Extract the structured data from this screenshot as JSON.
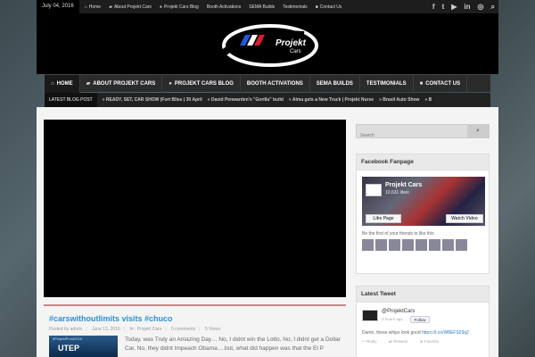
{
  "topbar": {
    "date": "July 04, 2016",
    "nav": [
      {
        "icon": "home-icon",
        "glyph": "⌂",
        "label": "Home"
      },
      {
        "icon": "car-icon",
        "glyph": "▰",
        "label": "About Projekt Cars"
      },
      {
        "icon": "chat-icon",
        "glyph": "●",
        "label": "Projekt Cars Blog"
      },
      {
        "icon": "",
        "glyph": "",
        "label": "Booth Activations"
      },
      {
        "icon": "",
        "glyph": "",
        "label": "SEMA Builds"
      },
      {
        "icon": "",
        "glyph": "",
        "label": "Testimonials"
      },
      {
        "icon": "contact-icon",
        "glyph": "■",
        "label": "Contact Us"
      }
    ],
    "social": [
      "f",
      "t",
      "▶",
      "in",
      "◎",
      "⌕"
    ]
  },
  "logo": {
    "text": "Projekt",
    "sub": "Cars"
  },
  "mainnav": [
    {
      "icon": "home-icon",
      "glyph": "⌂",
      "label": "HOME"
    },
    {
      "icon": "car-icon",
      "glyph": "▰",
      "label": "ABOUT PROJEKT CARS"
    },
    {
      "icon": "chat-icon",
      "glyph": "●",
      "label": "PROJEKT CARS BLOG"
    },
    {
      "icon": "",
      "glyph": "",
      "label": "BOOTH ACTIVATIONS"
    },
    {
      "icon": "",
      "glyph": "",
      "label": "SEMA BUILDS"
    },
    {
      "icon": "",
      "glyph": "",
      "label": "TESTIMONIALS"
    },
    {
      "icon": "contact-icon",
      "glyph": "■",
      "label": "CONTACT US"
    }
  ],
  "ticker": {
    "label": "LATEST BLOG POST",
    "items": [
      "READY, SET, CAR SHOW (Fort Bliss | 30 April",
      "David Penwarden's \"Gorilla\" build",
      "Alma gets a New Truck | Projekt Nurse",
      "Brasil Auto Show",
      "B"
    ]
  },
  "post": {
    "title": "#carswithoutlimits visits #chuco",
    "author": "Posted by admin",
    "date": "June 13, 2016",
    "category": "In : Projekt Cars",
    "comments": "0 comments",
    "views": "5 Views",
    "thumb_top": "#ProjektPond2016",
    "thumb_main": "UTEP",
    "excerpt": "Today, was Truly an Amazing Day… No, I didnt win the Lotto, No, I didnt get a Dollar Car, No, they didnt Impeach Obama….but, what did happen was that the El P"
  },
  "sidebar": {
    "search_placeholder": "Search",
    "fb": {
      "title": "Facebook Fanpage",
      "page_name": "Projekt Cars",
      "likes": "10,631 likes",
      "like_btn": "Like Page",
      "watch_btn": "Watch Video",
      "friends_text": "Be the first of your friends to like this"
    },
    "tweet": {
      "title": "Latest Tweet",
      "handle": "@ProjektCars",
      "time": "3 hours ago",
      "follow": "Follow",
      "text": "Damn, these whips look good ",
      "link": "https://t.co/W8EFS03q2",
      "reply": "Reply",
      "retweet": "Retweet",
      "favorite": "Favorite"
    }
  },
  "colors": {
    "accent": "#2d8fd1",
    "divider": "#c58a8a"
  }
}
